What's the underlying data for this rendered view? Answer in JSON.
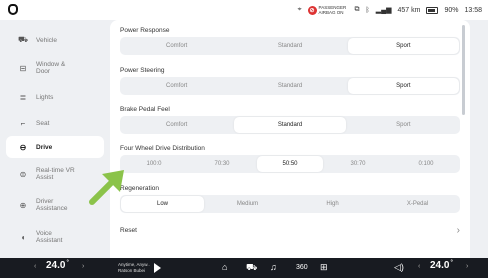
{
  "status_bar": {
    "airbag_label": "PASSENGER AIRBAG ON",
    "range": "457 km",
    "battery": "90%",
    "time": "13:58"
  },
  "sidebar": {
    "items": [
      {
        "label": "Vehicle",
        "icon": "car-icon"
      },
      {
        "label": "Window & Door",
        "icon": "window-icon"
      },
      {
        "label": "Lights",
        "icon": "lights-icon"
      },
      {
        "label": "Seat",
        "icon": "seat-icon"
      },
      {
        "label": "Drive",
        "icon": "steering-wheel-icon"
      },
      {
        "label": "Real-time VR Assist",
        "icon": "vr-icon"
      },
      {
        "label": "Driver Assistance",
        "icon": "assist-icon"
      },
      {
        "label": "Voice Assistant",
        "icon": "voice-icon"
      }
    ],
    "active": "Drive"
  },
  "drive": {
    "power_response": {
      "title": "Power Response",
      "options": [
        "Comfort",
        "Standard",
        "Sport"
      ],
      "selected": "Sport"
    },
    "power_steering": {
      "title": "Power Steering",
      "options": [
        "Comfort",
        "Standard",
        "Sport"
      ],
      "selected": "Sport"
    },
    "brake_pedal": {
      "title": "Brake Pedal Feel",
      "options": [
        "Comfort",
        "Standard",
        "Sport"
      ],
      "selected": "Standard"
    },
    "four_wheel": {
      "title": "Four Wheel Drive Distribution",
      "options": [
        "100:0",
        "70:30",
        "50:50",
        "30:70",
        "0:100"
      ],
      "selected": "50:50"
    },
    "regeneration": {
      "title": "Regeneration",
      "options": [
        "Low",
        "Medium",
        "High",
        "X-Pedal"
      ],
      "selected": "Low"
    },
    "reset_label": "Reset",
    "reset_chevron": "›"
  },
  "bottom_bar": {
    "left_temp": "24.0",
    "right_temp": "24.0",
    "temp_unit": "°",
    "media_title": "Anytime, Anyw..",
    "media_sub": "Ratson Bubei",
    "accent": "#8bc34a"
  }
}
